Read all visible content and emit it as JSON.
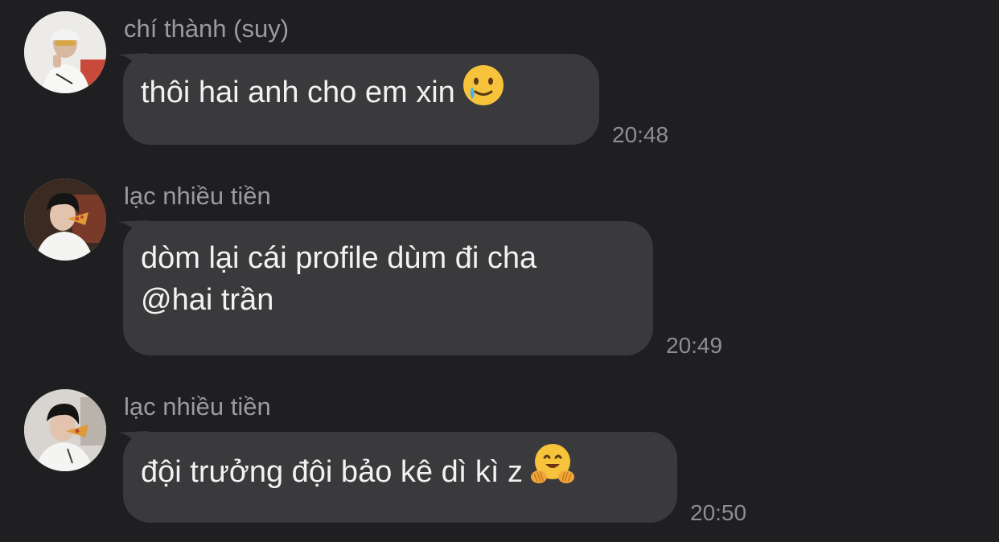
{
  "messages": [
    {
      "sender": "chí thành (suy)",
      "text_lines": [
        "thôi hai anh cho em xin"
      ],
      "emoji": "smiling-face-with-tear-icon",
      "time": "20:48"
    },
    {
      "sender": "lạc nhiều tiền",
      "text_lines": [
        "dòm lại cái profile dùm đi cha",
        "@hai trần"
      ],
      "emoji": "",
      "time": "20:49"
    },
    {
      "sender": "lạc nhiều tiền",
      "text_lines": [
        "đội trưởng đội bảo kê dì kì z"
      ],
      "emoji": "hugging-face-icon",
      "time": "20:50"
    }
  ],
  "colors": {
    "background": "#1f1f21",
    "bubble": "#3a3a3c",
    "sender_text": "#9b9b9f",
    "message_text": "#f2f2f2",
    "timestamp": "#8e8e93"
  }
}
